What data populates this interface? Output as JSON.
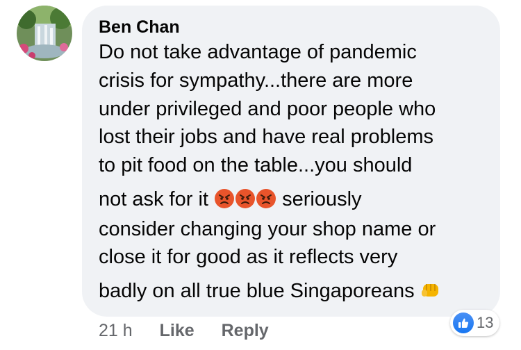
{
  "comment": {
    "author": "Ben Chan",
    "lines": {
      "l1": "Do not take advantage of pandemic",
      "l2": "crisis for sympathy...there are more",
      "l3": "under privileged and poor people who",
      "l4": "lost their jobs and have real problems",
      "l5": "to pit food on the table...you should",
      "l6a": "not ask for it",
      "l6b": "seriously",
      "l7": "consider changing your shop name or",
      "l8": "close it for good as it reflects very",
      "l9": "badly on all true blue Singaporeans"
    },
    "emojis": [
      "angry-face",
      "angry-face",
      "angry-face",
      "oncoming-fist"
    ]
  },
  "actions": {
    "time": "21 h",
    "like_label": "Like",
    "reply_label": "Reply"
  },
  "reactions": {
    "icon": "like-icon",
    "count": "13",
    "color": "#1877f2"
  },
  "colors": {
    "bubble": "#f0f2f5",
    "text": "#050505",
    "secondary": "#65676b"
  }
}
